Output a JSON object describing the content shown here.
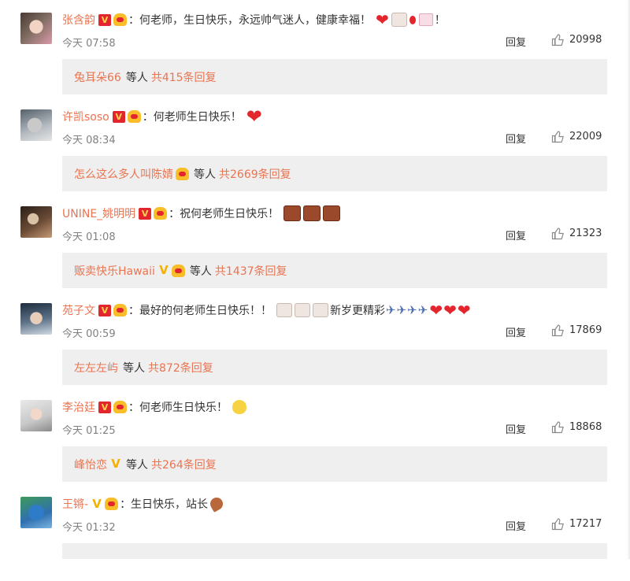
{
  "comments": [
    {
      "username": "张含韵",
      "text": "：何老师，生日快乐，永远帅气迷人，健康幸福！",
      "time": "今天 07:58",
      "reply_label": "回复",
      "likes": "20998",
      "reply_user": "兔耳朵66",
      "reply_mid": "等人",
      "reply_count": "共415条回复"
    },
    {
      "username": "许凯soso",
      "text": "：何老师生日快乐！",
      "time": "今天 08:34",
      "reply_label": "回复",
      "likes": "22009",
      "reply_user": "怎么这么多人叫陈婧",
      "reply_mid": "等人",
      "reply_count": "共2669条回复"
    },
    {
      "username": "UNINE_姚明明",
      "text": "：祝何老师生日快乐！",
      "time": "今天 01:08",
      "reply_label": "回复",
      "likes": "21323",
      "reply_user": "贩卖快乐Hawaii",
      "reply_mid": "等人",
      "reply_count": "共1437条回复"
    },
    {
      "username": "苑子文",
      "text": "：最好的何老师生日快乐！！",
      "text2": "新岁更精彩",
      "time": "今天 00:59",
      "reply_label": "回复",
      "likes": "17869",
      "reply_user": "左左左屿",
      "reply_mid": "等人",
      "reply_count": "共872条回复"
    },
    {
      "username": "李治廷",
      "text": "：何老师生日快乐！",
      "time": "今天 01:25",
      "reply_label": "回复",
      "likes": "18868",
      "reply_user": "峰怡恋",
      "reply_mid": "等人",
      "reply_count": "共264条回复"
    },
    {
      "username": "王锵-",
      "text": "：生日快乐，站长",
      "time": "今天 01:32",
      "reply_label": "回复",
      "likes": "17217"
    }
  ],
  "badges": {
    "v_red": "V",
    "v_gold": "V"
  },
  "colors": {
    "username": "#eb7350",
    "reply_box": "#efefef",
    "meta": "#808080"
  }
}
